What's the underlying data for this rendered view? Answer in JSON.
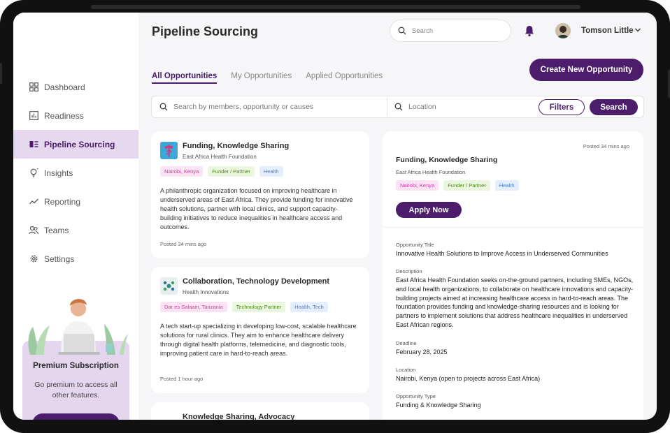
{
  "header": {
    "title": "Pipeline Sourcing",
    "search_placeholder": "Search",
    "user_name": "Tomson Little"
  },
  "sidebar": {
    "items": [
      {
        "label": "Dashboard",
        "icon": "grid-icon"
      },
      {
        "label": "Readiness",
        "icon": "bar-chart-icon"
      },
      {
        "label": "Pipeline Sourcing",
        "icon": "pipeline-icon",
        "active": true
      },
      {
        "label": "Insights",
        "icon": "lightbulb-icon"
      },
      {
        "label": "Reporting",
        "icon": "line-chart-icon"
      },
      {
        "label": "Teams",
        "icon": "people-icon"
      },
      {
        "label": "Settings",
        "icon": "gear-icon"
      }
    ],
    "promo": {
      "title": "Premium Subscription",
      "text": "Go premium to access all other features."
    }
  },
  "tabs": [
    {
      "label": "All Opportunities",
      "active": true
    },
    {
      "label": "My Opportunities"
    },
    {
      "label": "Applied Opportunities"
    }
  ],
  "create_button": "Create New Opportunity",
  "filters": {
    "search_placeholder": "Search by members, opportunity or causes",
    "location_placeholder": "Location",
    "filters_label": "Filters",
    "search_label": "Search"
  },
  "cards": [
    {
      "title": "Funding, Knowledge Sharing",
      "org": "East Africa Health Foundation",
      "tags": [
        "Nairobi, Kenya",
        "Funder / Partner",
        "Health"
      ],
      "description": "A philanthropic organization focused on improving healthcare in underserved areas of East Africa. They provide funding for innovative health solutions, partner with local clinics, and support capacity-building initiatives to reduce inequalities in healthcare access and outcomes.",
      "posted": "Posted 34 mins ago"
    },
    {
      "title": "Collaboration, Technology Development",
      "org": "Health Innovations",
      "tags": [
        "Dar es Salaam, Tanzania",
        "Technology Partner",
        "Health, Tech"
      ],
      "description": "A tech start-up specializing in developing low-cost, scalable healthcare solutions for rural clinics. They aim to enhance healthcare delivery through digital health platforms, telemedicine, and diagnostic tools, improving patient care in hard-to-reach areas.",
      "posted": "Posted 1 hour ago"
    },
    {
      "title": "Knowledge Sharing, Advocacy"
    }
  ],
  "detail": {
    "posted": "Posted 34 mins ago",
    "title": "Funding, Knowledge Sharing",
    "org": "East Africa Health Foundation",
    "tags": [
      "Nairobi, Kenya",
      "Funder / Partner",
      "Health"
    ],
    "apply_label": "Apply Now",
    "opportunity_title_label": "Opportunity Title",
    "opportunity_title": "Innovative Health Solutions to Improve Access in Underserved Communities",
    "description_label": "Description",
    "description": "East Africa Health Foundation seeks on-the-ground partners, including SMEs, NGOs, and local health organizations, to collaborate on healthcare innovations and capacity-building projects aimed at increasing healthcare access in hard-to-reach areas. The foundation provides funding and knowledge-sharing resources and is looking for partners to implement solutions that address healthcare inequalities in underserved East African regions.",
    "deadline_label": "Deadline",
    "deadline": "February 28, 2025",
    "location_label": "Location",
    "location": "Nairobi, Kenya (open to projects across East Africa)",
    "type_label": "Opportunity Type",
    "type": "Funding & Knowledge Sharing"
  },
  "colors": {
    "primary": "#4b1d6b",
    "active_nav_bg": "#e6d8ef",
    "promo_bg": "#e3d6ee",
    "tag_pink": "#d13aa7",
    "tag_green": "#4f8a1e",
    "tag_blue": "#4d7fd1"
  }
}
